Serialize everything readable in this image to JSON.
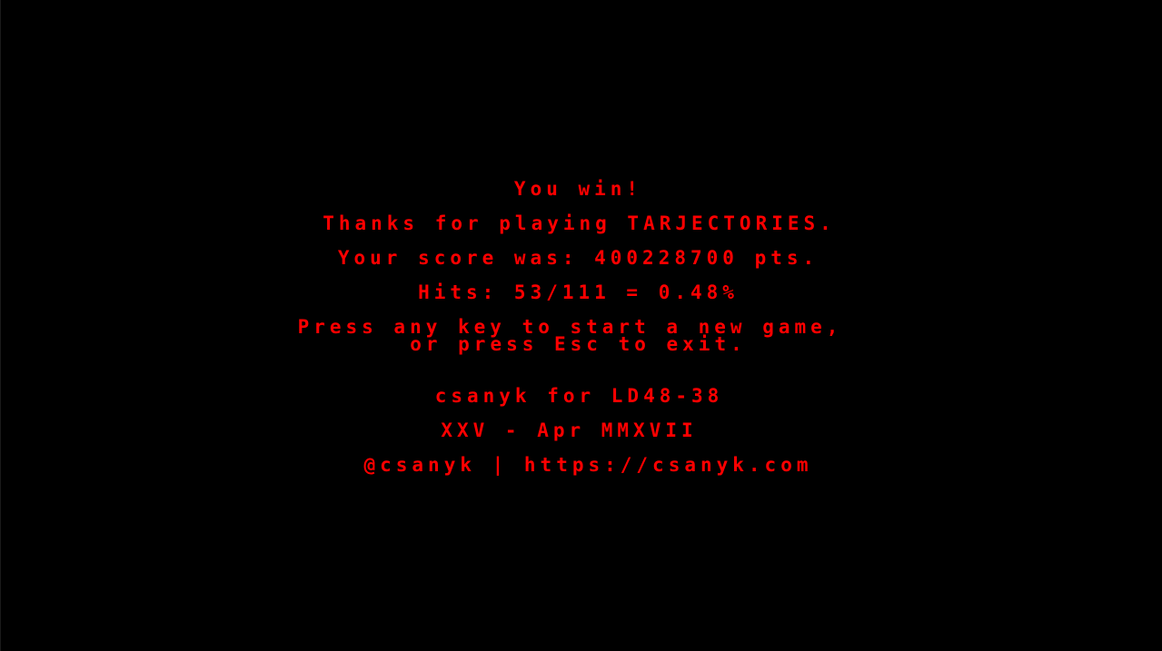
{
  "end_screen": {
    "win_message": "You win!",
    "thanks_message": "Thanks for playing TARJECTORIES.",
    "score_message": "Your score was: 400228700 pts.",
    "hits_message": "Hits: 53/111 = 0.48%",
    "prompt_line1": "Press any key to start a new game,",
    "prompt_line2": "or press Esc to exit."
  },
  "credits": {
    "author_line": "csanyk for LD48-38",
    "date_line": "XXV - Apr MMXVII",
    "contact_line": "@csanyk | https://csanyk.com"
  },
  "colors": {
    "background": "#000000",
    "text": "#ff0000"
  }
}
